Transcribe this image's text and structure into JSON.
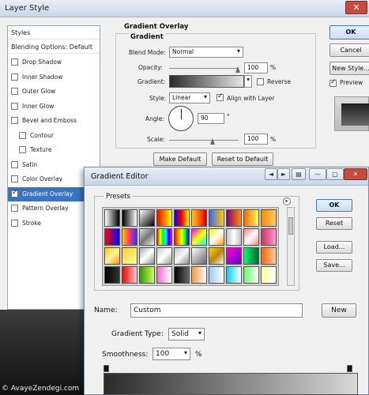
{
  "layer_style": {
    "title": "Layer Style",
    "close_glyph": "✕",
    "styles_header": "Styles",
    "blending_options": "Blending Options: Default",
    "items": [
      {
        "label": "Drop Shadow",
        "checked": false
      },
      {
        "label": "Inner Shadow",
        "checked": false
      },
      {
        "label": "Outer Glow",
        "checked": false
      },
      {
        "label": "Inner Glow",
        "checked": false
      },
      {
        "label": "Bevel and Emboss",
        "checked": false
      },
      {
        "label": "Contour",
        "checked": false,
        "indent": true
      },
      {
        "label": "Texture",
        "checked": false,
        "indent": true
      },
      {
        "label": "Satin",
        "checked": false
      },
      {
        "label": "Color Overlay",
        "checked": false
      },
      {
        "label": "Gradient Overlay",
        "checked": true,
        "selected": true
      },
      {
        "label": "Pattern Overlay",
        "checked": false
      },
      {
        "label": "Stroke",
        "checked": false
      }
    ],
    "gradient_overlay": {
      "section_title": "Gradient Overlay",
      "group_title": "Gradient",
      "blend_mode_label": "Blend Mode:",
      "blend_mode_value": "Normal",
      "opacity_label": "Opacity:",
      "opacity_value": "100",
      "percent": "%",
      "gradient_label": "Gradient:",
      "reverse_label": "Reverse",
      "style_label": "Style:",
      "style_value": "Linear",
      "align_label": "Align with Layer",
      "angle_label": "Angle:",
      "angle_value": "90",
      "degree": "°",
      "scale_label": "Scale:",
      "scale_value": "100",
      "make_default": "Make Default",
      "reset_default": "Reset to Default"
    },
    "buttons": {
      "ok": "OK",
      "cancel": "Cancel",
      "new_style": "New Style...",
      "preview": "Preview"
    }
  },
  "gradient_editor": {
    "title": "Gradient Editor",
    "presets_label": "Presets",
    "name_label": "Name:",
    "name_value": "Custom",
    "new_button": "New",
    "gradient_type_label": "Gradient Type:",
    "gradient_type_value": "Solid",
    "smoothness_label": "Smoothness:",
    "smoothness_value": "100",
    "percent": "%",
    "buttons": {
      "ok": "OK",
      "reset": "Reset",
      "load": "Load...",
      "save": "Save..."
    },
    "titlebar_glyphs": {
      "back": "◄",
      "forward": "►",
      "doc": "▤",
      "minimize": "—",
      "maximize": "▢",
      "close": "✕"
    },
    "swatches": [
      "linear-gradient(90deg,#ffffff,#000000)",
      "linear-gradient(90deg,#000,#fff)",
      "linear-gradient(135deg,#fff 0,#000 100%)",
      "linear-gradient(90deg,#ff0000,#ffff00)",
      "linear-gradient(90deg,#0000ff,#ff0000,#ffff00)",
      "linear-gradient(90deg,#ffcc00,#ff6600,#cc0000)",
      "linear-gradient(90deg,#3366ff,#ffcc00)",
      "linear-gradient(90deg,#800080,#ff8c00)",
      "linear-gradient(90deg,#ff6600,#ffff66)",
      "linear-gradient(90deg,#ff8800,#ffcc66)",
      "linear-gradient(90deg,#ff0000,#0000ff)",
      "linear-gradient(90deg,#ffcc00,#ff3366,#3333ff)",
      "linear-gradient(135deg,#ddd,#777,#eee)",
      "linear-gradient(90deg,#ff0000,#ffff00,#00ff00,#00ffff,#0000ff,#ff00ff)",
      "linear-gradient(90deg,#ff0000,#ff9900,#ffff00,#00ff00,#0000ff)",
      "linear-gradient(135deg,#ff00ff,#ffff00,#00ffff)",
      "linear-gradient(135deg,#ffee00,#ffffff,#ff9900)",
      "linear-gradient(90deg,#c0c0c0,#ffffff,#c0c0c0)",
      "linear-gradient(135deg,#ff8080,#fff 50%,#ff8080)",
      "linear-gradient(90deg,#cc3366,#ff99cc)",
      "linear-gradient(135deg,#ffcc00,#fff3a0,#ff9900)",
      "linear-gradient(135deg,#ffcc33,#ffff99)",
      "linear-gradient(135deg,#aaaaaa,#ffffff,#888888)",
      "linear-gradient(135deg,#cccccc,#ffffff,#999999)",
      "linear-gradient(135deg,#c0c0c0,#fafafa,#8a8a8a)",
      "linear-gradient(135deg,#ffffff,#666666)",
      "linear-gradient(135deg,#ffd700,#b8860b,#fff8dc)",
      "linear-gradient(135deg,#ff00cc,#6600cc)",
      "linear-gradient(90deg,#00ff66,#006633)",
      "linear-gradient(90deg,#ff6600,#ffcc99)",
      "linear-gradient(90deg,#000,#333)",
      "linear-gradient(90deg,#ff0000,#ffcccc)",
      "linear-gradient(90deg,#339900,#ccff66)",
      "linear-gradient(90deg,#ff66cc,#ffffff)",
      "linear-gradient(90deg,#000000,#666666)",
      "linear-gradient(90deg,#ff9933,#ffffff)",
      "linear-gradient(90deg,#99ccff,#ffffff)",
      "linear-gradient(90deg,#00ccff,#ffffff)",
      "linear-gradient(90deg,#66ff66,#ffffff)",
      "linear-gradient(90deg,#ffff99,#ffffff)"
    ]
  },
  "watermark": "© AvayeZendegi.com"
}
